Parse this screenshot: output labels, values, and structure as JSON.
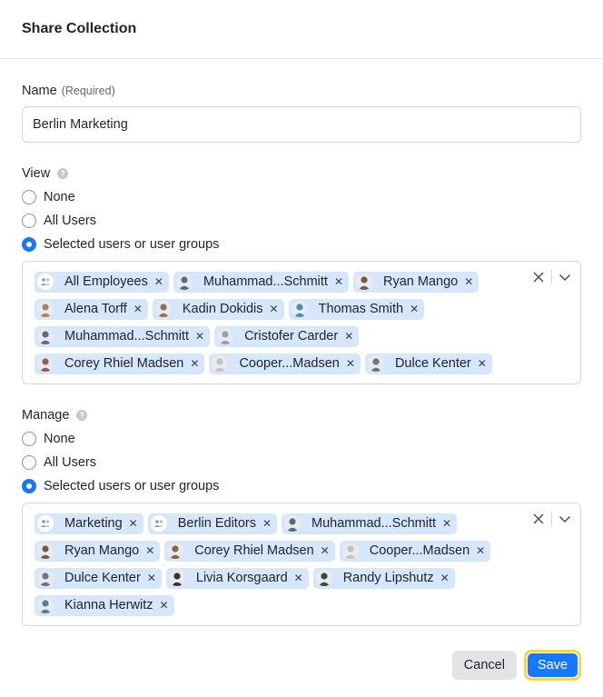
{
  "dialog": {
    "title": "Share Collection"
  },
  "name_field": {
    "label": "Name",
    "required_note": "(Required)",
    "value": "Berlin Marketing"
  },
  "view": {
    "label": "View",
    "help_icon": "?",
    "options": [
      "None",
      "All Users",
      "Selected users or user groups"
    ],
    "selected": 2,
    "tags": [
      {
        "label": "All Employees",
        "kind": "group"
      },
      {
        "label": "Muhammad...Schmitt",
        "kind": "user",
        "color": "#5b6b7a"
      },
      {
        "label": "Ryan Mango",
        "kind": "user",
        "color": "#7a5a44"
      },
      {
        "label": "Alena Torff",
        "kind": "user",
        "color": "#b08060"
      },
      {
        "label": "Kadin Dokidis",
        "kind": "user",
        "color": "#8a7350"
      },
      {
        "label": "Thomas Smith",
        "kind": "user",
        "color": "#4f8fa8"
      },
      {
        "label": "Muhammad...Schmitt",
        "kind": "user",
        "color": "#5b6b7a"
      },
      {
        "label": "Cristofer Carder",
        "kind": "user",
        "color": "#9aa0a6"
      },
      {
        "label": "Corey Rhiel Madsen",
        "kind": "user",
        "color": "#8c6248"
      },
      {
        "label": "Cooper...Madsen",
        "kind": "user",
        "color": "#c9c2b8"
      },
      {
        "label": "Dulce Kenter",
        "kind": "user",
        "color": "#6d7480"
      }
    ]
  },
  "manage": {
    "label": "Manage",
    "help_icon": "?",
    "options": [
      "None",
      "All Users",
      "Selected users or user groups"
    ],
    "selected": 2,
    "tags": [
      {
        "label": "Marketing",
        "kind": "group"
      },
      {
        "label": "Berlin Editors",
        "kind": "group"
      },
      {
        "label": "Muhammad...Schmitt",
        "kind": "user",
        "color": "#5b6b7a"
      },
      {
        "label": "Ryan Mango",
        "kind": "user",
        "color": "#7a5a44"
      },
      {
        "label": "Corey Rhiel Madsen",
        "kind": "user",
        "color": "#8c6248"
      },
      {
        "label": "Cooper...Madsen",
        "kind": "user",
        "color": "#c9c2b8"
      },
      {
        "label": "Dulce Kenter",
        "kind": "user",
        "color": "#6d7480"
      },
      {
        "label": "Livia Korsgaard",
        "kind": "user",
        "color": "#3c3434"
      },
      {
        "label": "Randy Lipshutz",
        "kind": "user",
        "color": "#3d4a3a"
      },
      {
        "label": "Kianna Herwitz",
        "kind": "user",
        "color": "#5a7a94"
      }
    ]
  },
  "icons": {
    "tag_remove": "✕",
    "clear": "clear-icon",
    "chevron": "chevron-down-icon"
  },
  "footer": {
    "cancel_label": "Cancel",
    "save_label": "Save"
  },
  "colors": {
    "accent": "#1677ff",
    "tag_bg": "#d6e6fb",
    "focus_ring": "#f7d54a"
  }
}
